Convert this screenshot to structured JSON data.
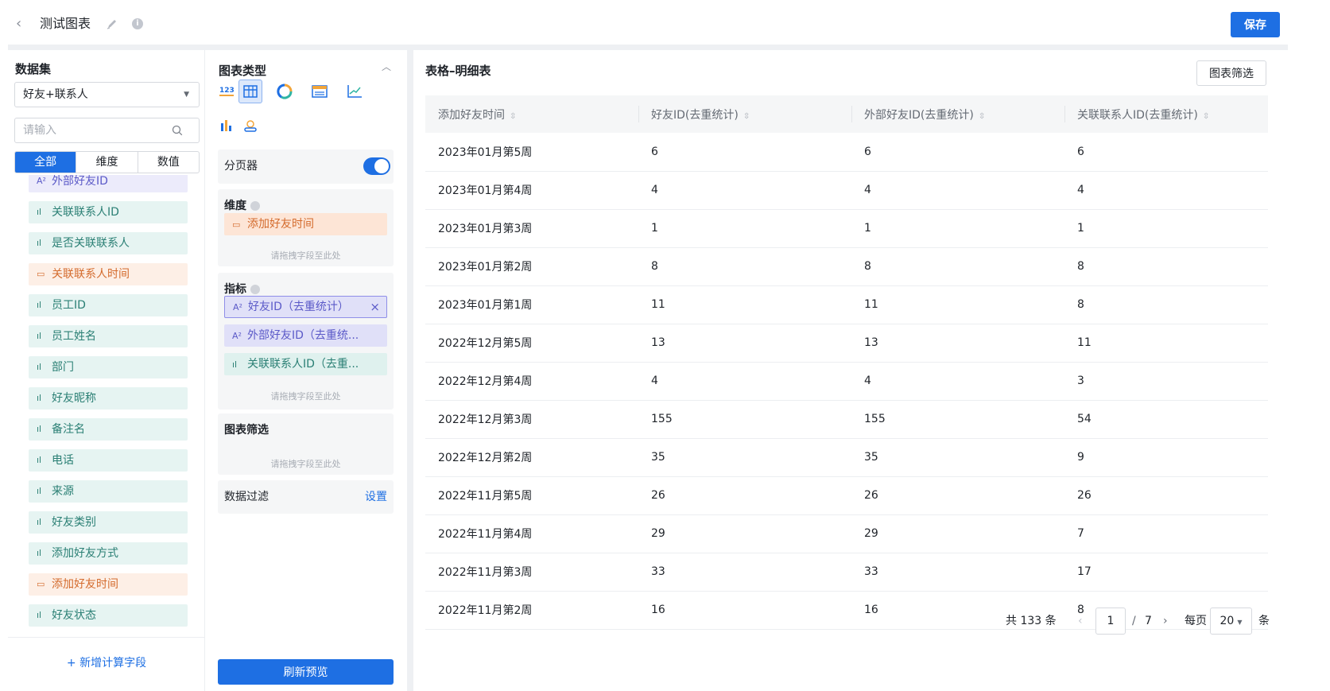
{
  "header": {
    "back_glyph": "‹",
    "title": "测试图表",
    "info_glyph": "i",
    "save_label": "保存"
  },
  "dataset_panel": {
    "title": "数据集",
    "selected_dataset": "好友+联系人",
    "search_placeholder": "请输入",
    "tabs": [
      "全部",
      "维度",
      "数值"
    ],
    "fields": [
      {
        "icon": "A²",
        "label": "外部好友ID",
        "kind": "meas"
      },
      {
        "icon": "ıl",
        "label": "关联联系人ID",
        "kind": "dim"
      },
      {
        "icon": "ıl",
        "label": "是否关联联系人",
        "kind": "dim"
      },
      {
        "icon": "▭",
        "label": "关联联系人时间",
        "kind": "date"
      },
      {
        "icon": "ıl",
        "label": "员工ID",
        "kind": "dim"
      },
      {
        "icon": "ıl",
        "label": "员工姓名",
        "kind": "dim"
      },
      {
        "icon": "ıl",
        "label": "部门",
        "kind": "dim"
      },
      {
        "icon": "ıl",
        "label": "好友昵称",
        "kind": "dim"
      },
      {
        "icon": "ıl",
        "label": "备注名",
        "kind": "dim"
      },
      {
        "icon": "ıl",
        "label": "电话",
        "kind": "dim"
      },
      {
        "icon": "ıl",
        "label": "来源",
        "kind": "dim"
      },
      {
        "icon": "ıl",
        "label": "好友类别",
        "kind": "dim"
      },
      {
        "icon": "ıl",
        "label": "添加好友方式",
        "kind": "dim"
      },
      {
        "icon": "▭",
        "label": "添加好友时间",
        "kind": "date"
      },
      {
        "icon": "ıl",
        "label": "好友状态",
        "kind": "dim"
      }
    ],
    "add_calc_label": "+ 新增计算字段"
  },
  "config_panel": {
    "chart_type_title": "图表类型",
    "pager_label": "分页器",
    "dimension_title": "维度",
    "dimension_fields": [
      {
        "icon": "▭",
        "label": "添加好友时间"
      }
    ],
    "metric_title": "指标",
    "metric_fields": [
      {
        "icon": "A²",
        "label": "好友ID（去重统计）"
      },
      {
        "icon": "A²",
        "label": "外部好友ID（去重统..."
      },
      {
        "icon": "ıl",
        "label": "关联联系人ID（去重..."
      }
    ],
    "drop_hint": "请拖拽字段至此处",
    "chart_filter_title": "图表筛选",
    "data_filter_label": "数据过滤",
    "data_filter_link": "设置",
    "refresh_label": "刷新预览",
    "remove_glyph": "×"
  },
  "preview": {
    "title": "表格–明细表",
    "filter_button": "图表筛选",
    "columns": [
      "添加好友时间",
      "好友ID(去重统计)",
      "外部好友ID(去重统计)",
      "关联联系人ID(去重统计)"
    ],
    "rows": [
      [
        "2023年01月第5周",
        "6",
        "6",
        "6"
      ],
      [
        "2023年01月第4周",
        "4",
        "4",
        "4"
      ],
      [
        "2023年01月第3周",
        "1",
        "1",
        "1"
      ],
      [
        "2023年01月第2周",
        "8",
        "8",
        "8"
      ],
      [
        "2023年01月第1周",
        "11",
        "11",
        "8"
      ],
      [
        "2022年12月第5周",
        "13",
        "13",
        "11"
      ],
      [
        "2022年12月第4周",
        "4",
        "4",
        "3"
      ],
      [
        "2022年12月第3周",
        "155",
        "155",
        "54"
      ],
      [
        "2022年12月第2周",
        "35",
        "35",
        "9"
      ],
      [
        "2022年11月第5周",
        "26",
        "26",
        "26"
      ],
      [
        "2022年11月第4周",
        "29",
        "29",
        "7"
      ],
      [
        "2022年11月第3周",
        "33",
        "33",
        "17"
      ],
      [
        "2022年11月第2周",
        "16",
        "16",
        "8"
      ]
    ],
    "pagination": {
      "total": "共 133 条",
      "current_page": "1",
      "page_sep": "/",
      "total_pages": "7",
      "per_page_label": "每页",
      "page_size": "20",
      "unit": "条"
    }
  },
  "colors": {
    "primary": "#1e6fe3",
    "dimension_field": "#e6f4f2",
    "measure_field": "#ecebfb",
    "date_field": "#fdefe6"
  }
}
